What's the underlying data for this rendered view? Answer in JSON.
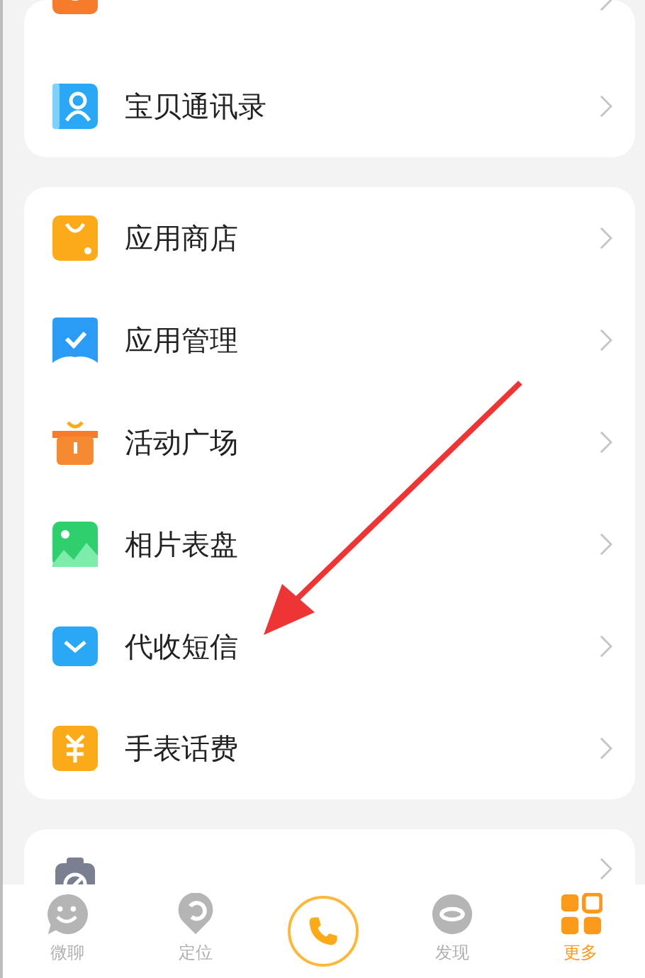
{
  "sections": [
    {
      "items": [
        {
          "kind": "members",
          "clipped_top": true
        },
        {
          "kind": "contacts",
          "label": "宝贝通讯录"
        }
      ]
    },
    {
      "items": [
        {
          "kind": "store",
          "label": "应用商店"
        },
        {
          "kind": "apps",
          "label": "应用管理"
        },
        {
          "kind": "gift",
          "label": "活动广场"
        },
        {
          "kind": "photo",
          "label": "相片表盘"
        },
        {
          "kind": "sms",
          "label": "代收短信"
        },
        {
          "kind": "bill",
          "label": "手表话费"
        }
      ]
    },
    {
      "items": [
        {
          "kind": "ban",
          "clipped_bottom": true
        }
      ]
    }
  ],
  "tab_bar": [
    {
      "kind": "chat",
      "label": "微聊",
      "selected": false
    },
    {
      "kind": "locate",
      "label": "定位",
      "selected": false
    },
    {
      "kind": "call"
    },
    {
      "kind": "discover",
      "label": "发现",
      "selected": false
    },
    {
      "kind": "more",
      "label": "更多",
      "selected": true
    }
  ]
}
